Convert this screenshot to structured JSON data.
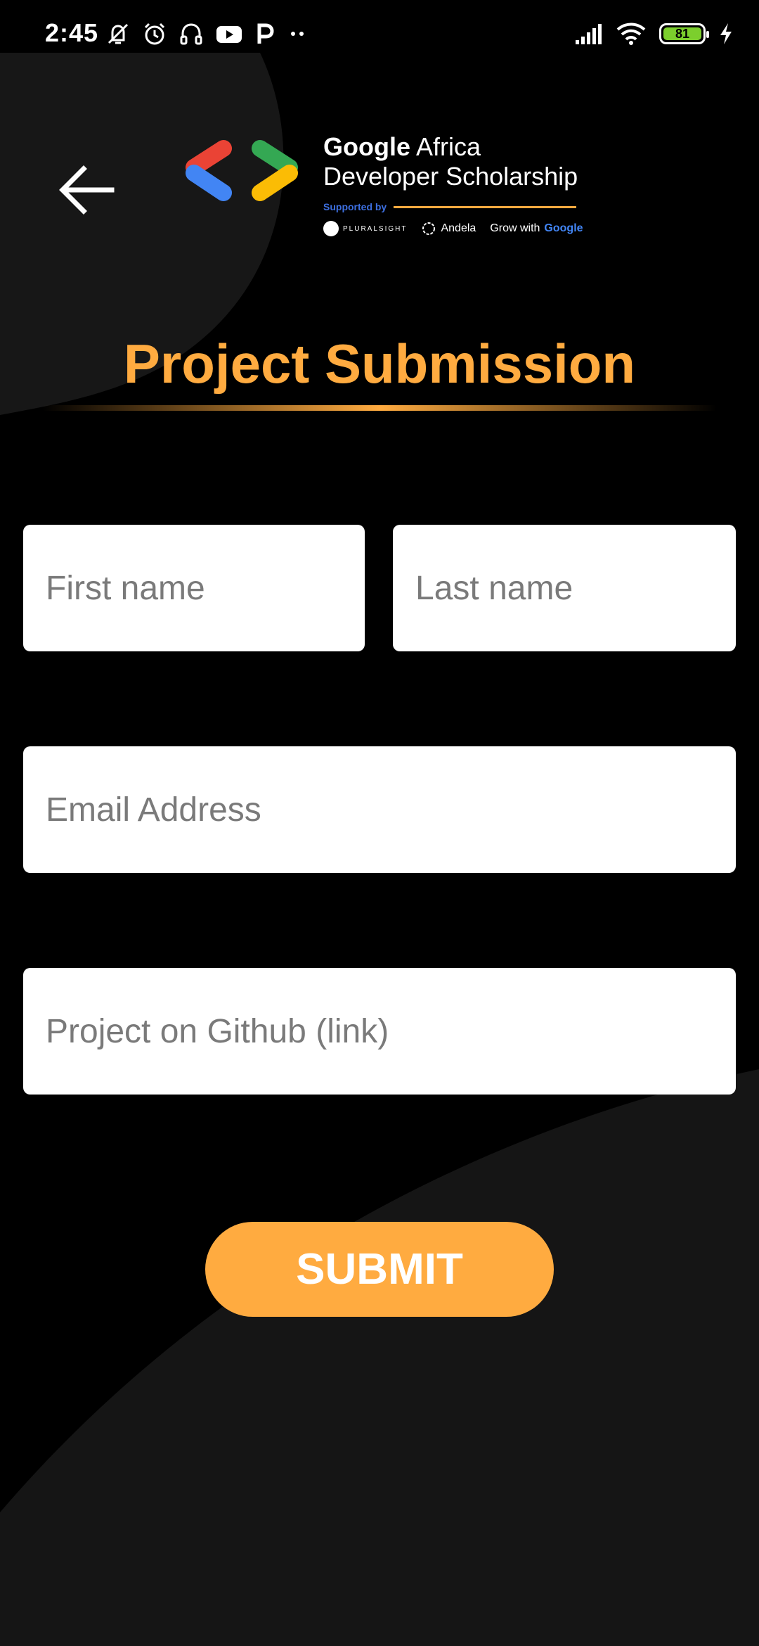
{
  "status_bar": {
    "time": "2:45",
    "battery_level": "81",
    "left_icons": [
      "vibrate-off-icon",
      "alarm-icon",
      "headset-icon",
      "youtube-icon",
      "p-app-icon",
      "more-dots-icon"
    ],
    "right_icons": [
      "signal-icon",
      "wifi-icon",
      "battery-icon",
      "charging-icon"
    ]
  },
  "header": {
    "back_icon": "arrow-left-icon",
    "logo": {
      "line1_bold": "Google",
      "line1_rest": " Africa",
      "line2": "Developer Scholarship",
      "supported_by": "Supported by",
      "partners": {
        "pluralsight": "PLURALSIGHT",
        "andela": "Andela",
        "grow_prefix": "Grow with ",
        "grow_google": "Google"
      }
    }
  },
  "page": {
    "title": "Project Submission"
  },
  "form": {
    "first_name": {
      "placeholder": "First name",
      "value": ""
    },
    "last_name": {
      "placeholder": "Last name",
      "value": ""
    },
    "email": {
      "placeholder": "Email Address",
      "value": ""
    },
    "github": {
      "placeholder": "Project on Github (link)",
      "value": ""
    },
    "submit_label": "SUBMIT"
  },
  "colors": {
    "accent": "#ffab40",
    "background": "#000000",
    "background_shape": "#151515",
    "field_background": "#ffffff",
    "placeholder": "#7a7a7a",
    "logo_red": "#ea4335",
    "logo_blue": "#4285f4",
    "logo_green": "#34a853",
    "logo_yellow": "#fbbc05"
  }
}
